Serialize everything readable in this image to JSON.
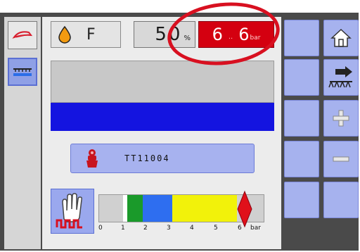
{
  "status": {
    "fuel_letter": "F",
    "percent_value": "50",
    "percent_unit": "%",
    "pressure_left": "6",
    "pressure_right": "6",
    "pressure_separator": "..",
    "pressure_unit": "bar"
  },
  "nozzle": {
    "label": "TT11004"
  },
  "pressure_scale": {
    "ticks": [
      "0",
      "1",
      "2",
      "3",
      "4",
      "5",
      "6",
      "bar"
    ],
    "colors": {
      "green": "#1a9a2a",
      "blue": "#2e6ef0",
      "yellow": "#f2f20a",
      "indicator": "#e0101a"
    },
    "current_value": 6
  },
  "colors": {
    "selected_button": "#8fa0e6",
    "soft_button": "#a6b2ee",
    "highlight_bar": "#1414e0",
    "alarm_red": "#d40010"
  },
  "icons": {
    "left": [
      "sprayer-icon",
      "boom-icon"
    ],
    "right": [
      "home-icon",
      "boom-section-icon",
      "plus-icon",
      "minus-icon"
    ],
    "status": [
      "fuel-drop-icon",
      "nozzle-icon",
      "glove-icon"
    ]
  }
}
